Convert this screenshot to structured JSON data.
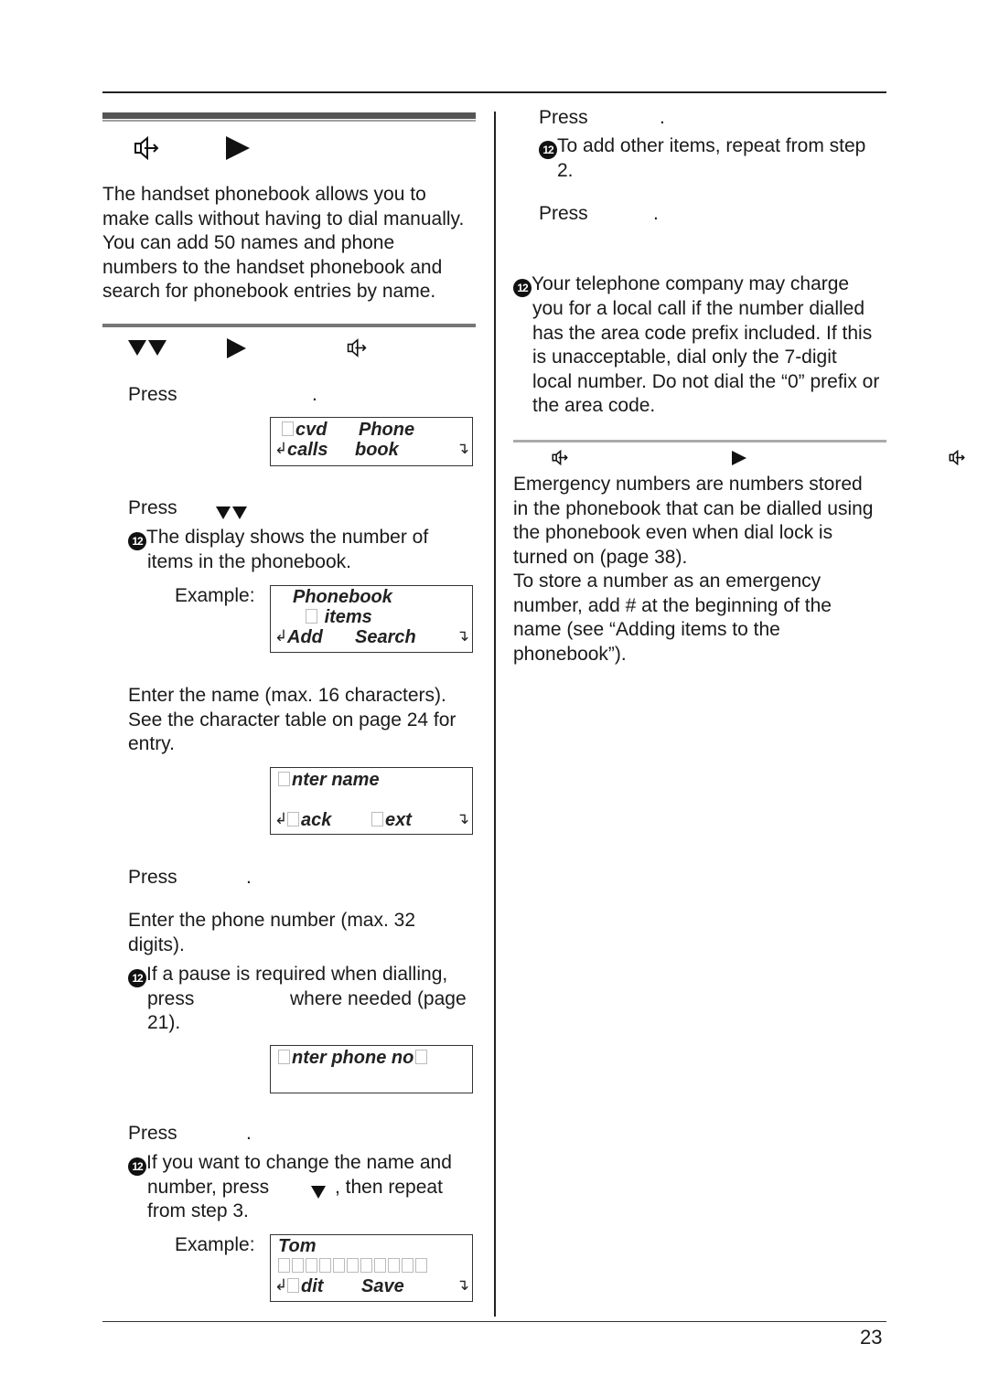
{
  "page": {
    "number": "23"
  },
  "left": {
    "header_icons": [
      "speaker-arrow-icon",
      "right-triangle-icon"
    ],
    "intro": [
      "The handset phonebook allows you to",
      "make calls without having to dial manually.",
      "You can add 50 names and phone",
      "numbers to the handset phonebook and",
      "search for phonebook entries by name."
    ],
    "sub_icons": [
      "double-down-triangle-icon",
      "right-triangle-icon",
      "speaker-arrow-icon"
    ],
    "step1": {
      "press": "Press",
      "period": "."
    },
    "lcd1": {
      "line1_a": "cvd",
      "line1_b": "Phone",
      "line2_a": "calls",
      "line2_b": "book"
    },
    "step2": {
      "press": "Press",
      "note": "The display shows the number of",
      "note2": "items in the phonebook.",
      "example": "Example:"
    },
    "lcd2": {
      "line1": "Phonebook",
      "line2": "items",
      "line3_a": "Add",
      "line3_b": "Search"
    },
    "step3": [
      "Enter the name (max. 16 characters).",
      "See the character table on page 24 for",
      "entry."
    ],
    "lcd3": {
      "line1": "nter name",
      "soft_a": "ack",
      "soft_b": "ext"
    },
    "step4": {
      "press": "Press",
      "period": "."
    },
    "step5": {
      "lines": [
        "Enter the phone number (max. 32",
        "digits)."
      ],
      "note1": "If a pause is required when dialling,",
      "note2_a": "press",
      "note2_b": "where needed (page",
      "note3": "21)."
    },
    "lcd4": {
      "line1": "nter phone no"
    },
    "step6": {
      "press": "Press",
      "period": ".",
      "note1": "If you want to change the name and",
      "note2_a": "number, press",
      "note2_b": ", then repeat",
      "note3": "from step 3.",
      "example": "Example:"
    },
    "lcd5": {
      "line1": "Tom",
      "soft_a": "dit",
      "soft_b": "Save"
    }
  },
  "right": {
    "step7": {
      "press": "Press",
      "period": "."
    },
    "note_repeat": [
      "To add other items, repeat from step",
      "2."
    ],
    "step8": {
      "press": "Press",
      "period": "."
    },
    "note_charge": [
      "Your telephone company may charge",
      "you for a local call if the number dialled",
      "has the area code prefix included. If this",
      "is unacceptable, dial only the 7-digit",
      "local number. Do not dial the “0” prefix or",
      "the area code."
    ],
    "emergency_icons": [
      "speaker-arrow-icon",
      "right-triangle-icon",
      "speaker-arrow-icon"
    ],
    "emergency": [
      "Emergency numbers are numbers stored",
      "in the phonebook that can be dialled using",
      "the phonebook even when dial lock is",
      "turned on (page 38).",
      "To store a number as an emergency",
      "number, add # at the beginning of the",
      "name (see “Adding items to the",
      "phonebook”)."
    ]
  },
  "bullet_glyph": "12"
}
